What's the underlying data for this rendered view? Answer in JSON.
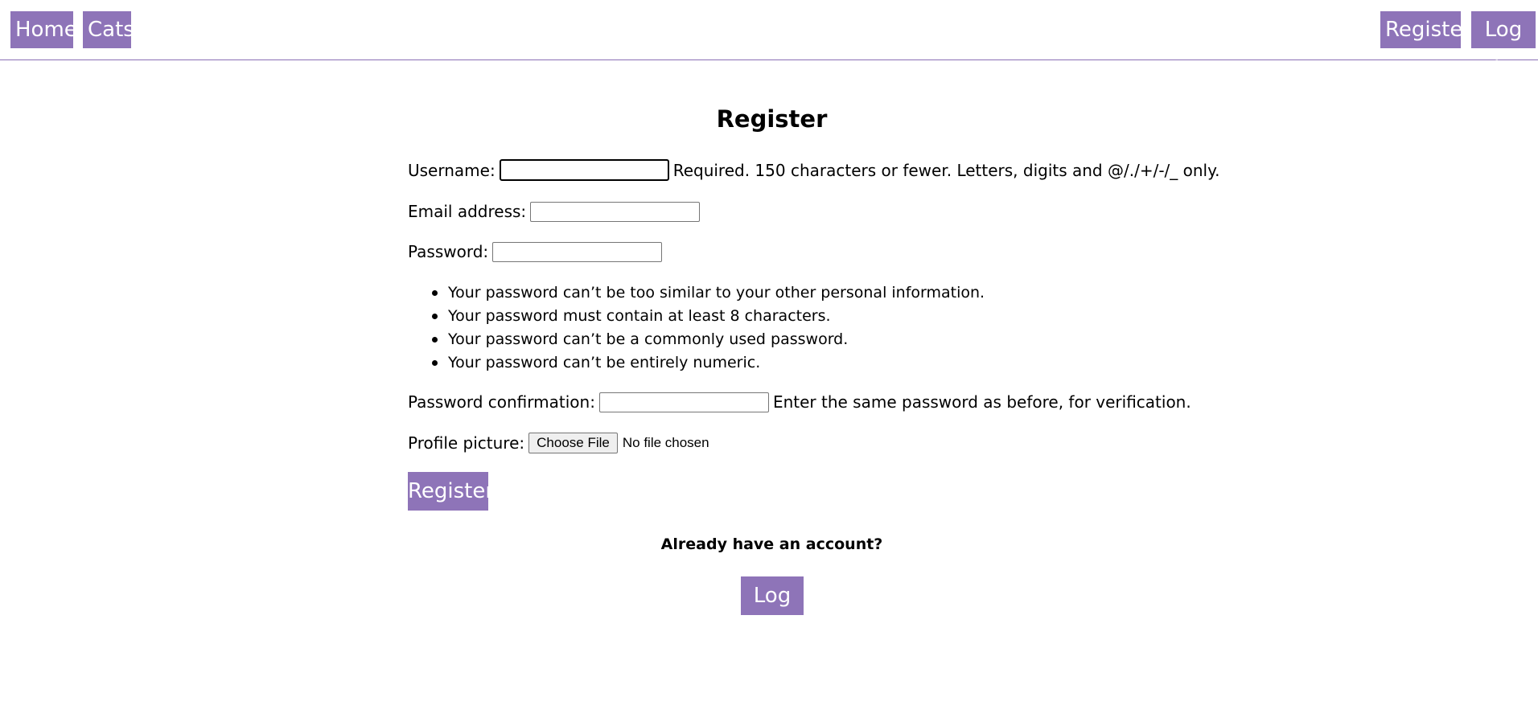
{
  "nav": {
    "home": "Home",
    "cats": "Cats",
    "register": "Register",
    "login": "Log in",
    "accent_color": "#8e74b8"
  },
  "page": {
    "title": "Register"
  },
  "form": {
    "username_label": "Username:",
    "username_value": "",
    "username_help": "Required. 150 characters or fewer. Letters, digits and @/./+/-/_ only.",
    "email_label": "Email address:",
    "email_value": "",
    "password_label": "Password:",
    "password_value": "",
    "password_rules": [
      "Your password can’t be too similar to your other personal information.",
      "Your password must contain at least 8 characters.",
      "Your password can’t be a commonly used password.",
      "Your password can’t be entirely numeric."
    ],
    "confirm_label": "Password confirmation:",
    "confirm_value": "",
    "confirm_help": "Enter the same password as before, for verification.",
    "picture_label": "Profile picture:",
    "picture_button": "Choose File",
    "picture_status": "No file chosen",
    "submit_label": "Register"
  },
  "footer": {
    "question": "Already have an account?",
    "login_label": "Log in"
  }
}
